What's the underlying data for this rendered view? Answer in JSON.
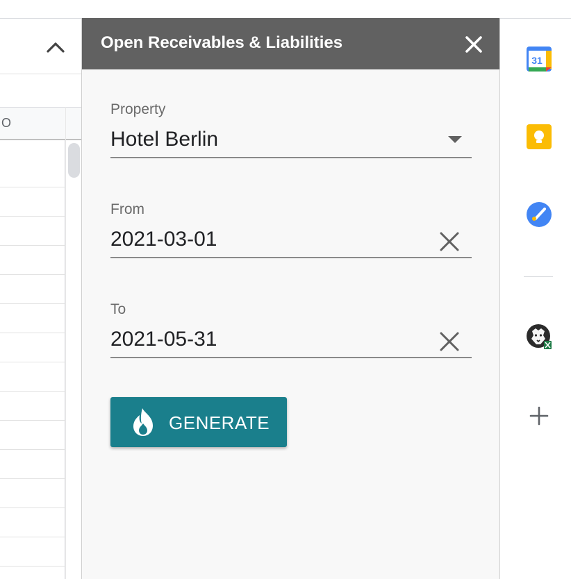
{
  "sheet": {
    "column_label": "O"
  },
  "panel": {
    "title": "Open Receivables & Liabilities",
    "fields": {
      "property": {
        "label": "Property",
        "value": "Hotel Berlin"
      },
      "from": {
        "label": "From",
        "value": "2021-03-01"
      },
      "to": {
        "label": "To",
        "value": "2021-05-31"
      }
    },
    "generate_label": "GENERATE"
  },
  "rail": {
    "calendar_date": "31",
    "icons": [
      "calendar-icon",
      "keep-icon",
      "tasks-icon",
      "lion-addon-icon",
      "add-icon"
    ]
  },
  "colors": {
    "header": "#616161",
    "accent": "#1a7f8c",
    "panel_bg": "#f8f8f8"
  }
}
